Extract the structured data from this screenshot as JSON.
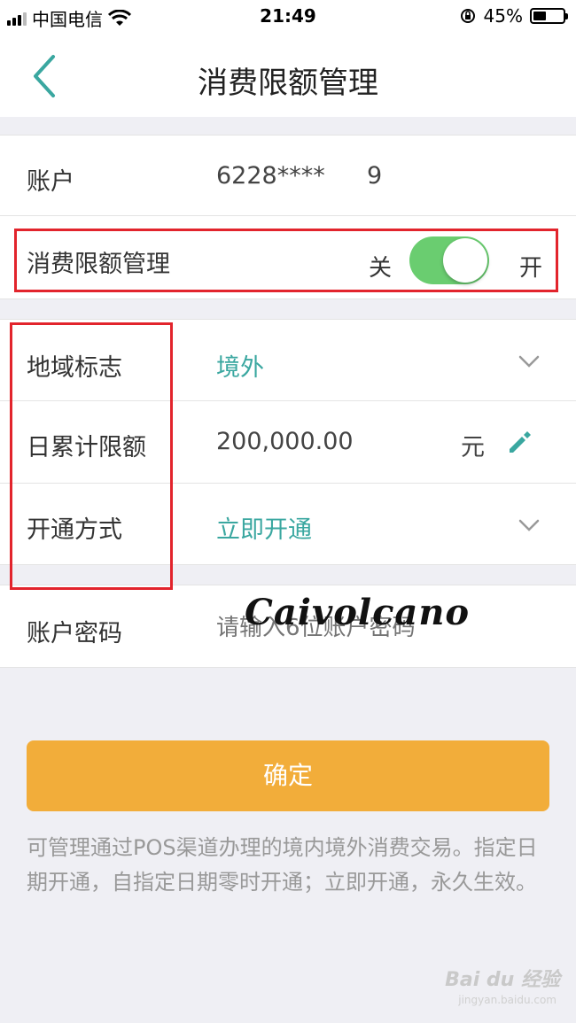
{
  "status_bar": {
    "carrier": "中国电信",
    "time": "21:49",
    "battery": "45%",
    "battery_level": 0.45
  },
  "nav": {
    "title": "消费限额管理"
  },
  "account": {
    "label": "账户",
    "number": "6228****",
    "suffix": "9"
  },
  "limit_management": {
    "label": "消费限额管理",
    "off_label": "关",
    "on_label": "开",
    "enabled": true
  },
  "region": {
    "label": "地域标志",
    "value": "境外"
  },
  "daily_limit": {
    "label": "日累计限额",
    "value": "200,000.00",
    "unit": "元"
  },
  "activation": {
    "label": "开通方式",
    "value": "立即开通"
  },
  "password": {
    "label": "账户密码",
    "placeholder": "请输入6位账户密码"
  },
  "watermark": "Caivolcano",
  "confirm_button": "确定",
  "note": "可管理通过POS渠道办理的境内境外消费交易。指定日期开通，自指定日期零时开通；立即开通，永久生效。",
  "baidu_watermark": "Bai du 经验",
  "baidu_url": "jingyan.baidu.com",
  "colors": {
    "accent_teal": "#3aa7a0",
    "switch_green": "#6acd70",
    "button_orange": "#f2ad3a",
    "highlight_red": "#e2242c"
  }
}
